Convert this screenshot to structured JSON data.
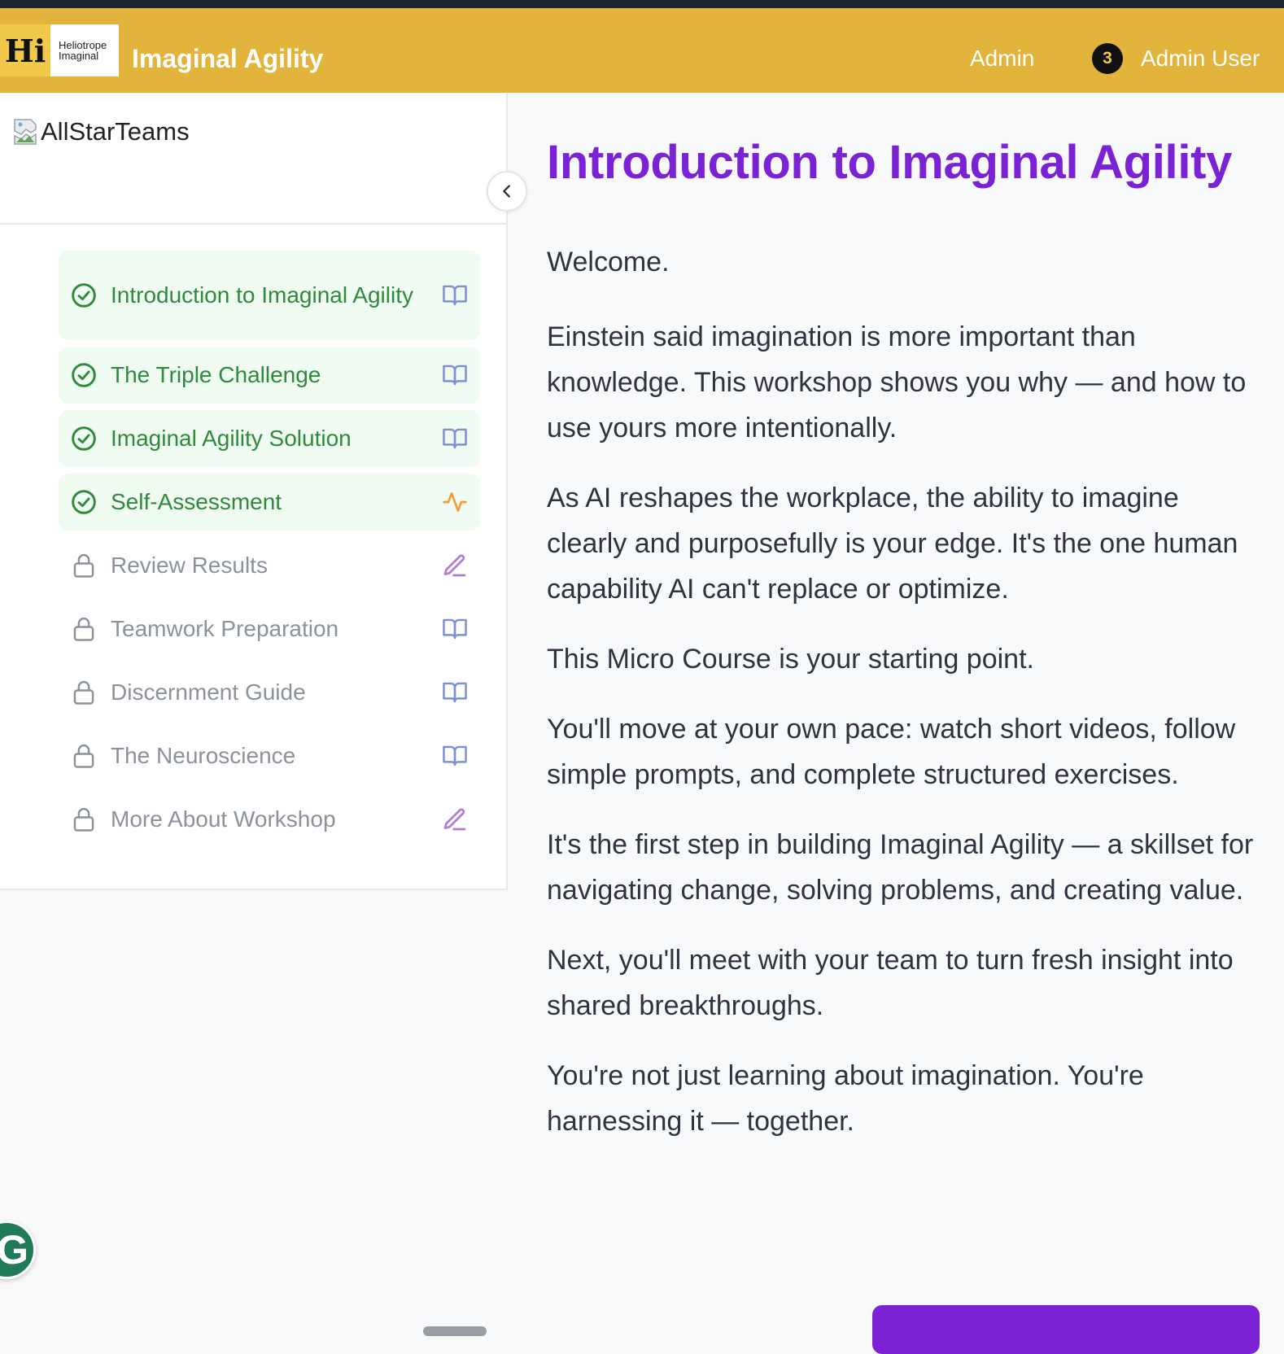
{
  "header": {
    "logo_hi": "Hi",
    "logo_line1": "Heliotrope",
    "logo_line2": "Imaginal",
    "app_title": "Imaginal Agility",
    "admin_link": "Admin",
    "notification_count": "3",
    "user_name": "Admin User"
  },
  "sidebar": {
    "brand_alt": "AllStarTeams",
    "steps": [
      {
        "label": "Introduction to Imaginal Agility",
        "status": "done",
        "icon": "book-icon"
      },
      {
        "label": "The Triple Challenge",
        "status": "done",
        "icon": "book-icon"
      },
      {
        "label": "Imaginal Agility Solution",
        "status": "done",
        "icon": "book-icon"
      },
      {
        "label": "Self-Assessment",
        "status": "done",
        "icon": "activity-icon"
      },
      {
        "label": "Review Results",
        "status": "locked",
        "icon": "pencil-icon"
      },
      {
        "label": "Teamwork Preparation",
        "status": "locked",
        "icon": "book-icon"
      },
      {
        "label": "Discernment Guide",
        "status": "locked",
        "icon": "book-icon"
      },
      {
        "label": "The Neuroscience",
        "status": "locked",
        "icon": "book-icon"
      },
      {
        "label": "More About Workshop",
        "status": "locked",
        "icon": "pencil-icon"
      }
    ]
  },
  "main": {
    "title": "Introduction to Imaginal Agility",
    "paragraphs": [
      "Welcome.",
      "Einstein said imagination is more important than knowledge. This workshop shows you why — and how to use yours more intentionally.",
      "As AI reshapes the workplace, the ability to imagine clearly and purposefully is your edge. It's the one human capability AI can't replace or optimize.",
      "This Micro Course is your starting point.",
      "You'll move at your own pace: watch short videos, follow simple prompts, and complete structured exercises.",
      "It's the first step in building Imaginal Agility — a skillset for navigating change, solving problems, and creating value.",
      "Next, you'll meet with your team to turn fresh insight into shared breakthroughs.",
      "You're not just learning about imagination. You're harnessing it — together."
    ]
  },
  "floating": {
    "g_label": "G"
  },
  "colors": {
    "header_bg": "#e2b43c",
    "title_purple": "#7a22d4",
    "done_green": "#2f8a3c",
    "done_bg": "#f0fbf2",
    "locked_gray": "#8b929c",
    "book_blue": "#7b8fd9",
    "activity_orange": "#f29b3a",
    "pencil_purple": "#b07ad9"
  }
}
